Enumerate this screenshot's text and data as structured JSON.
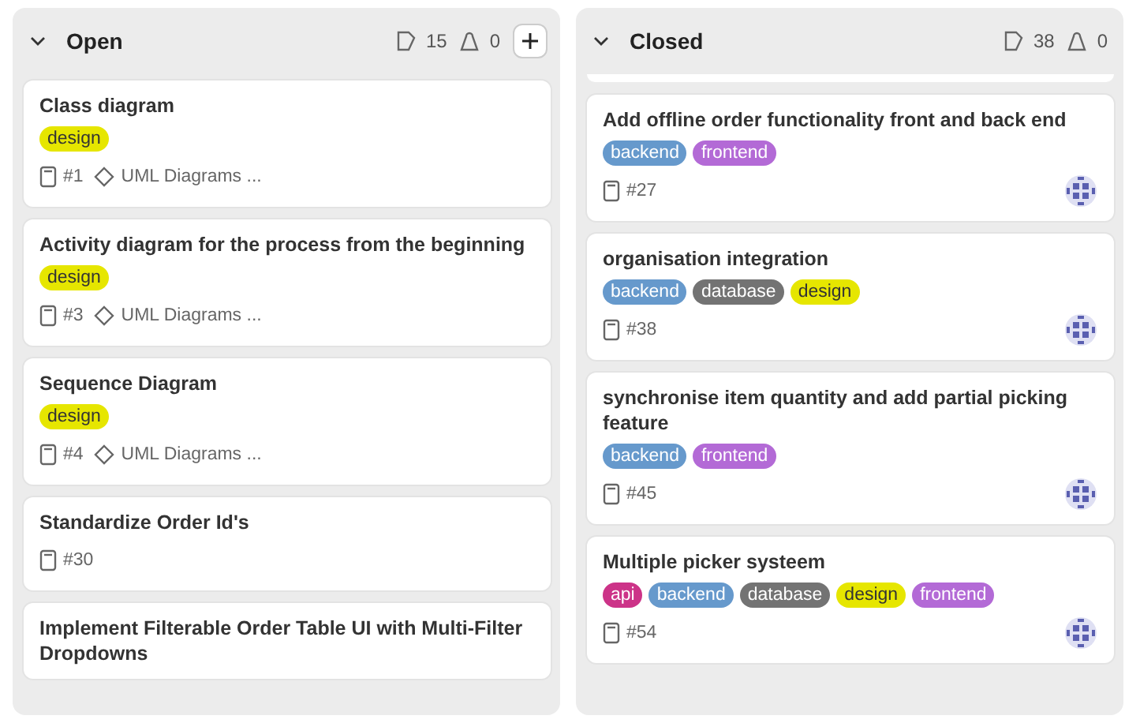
{
  "columns": [
    {
      "title": "Open",
      "issue_count": "15",
      "weight": "0",
      "can_add": true,
      "cards": [
        {
          "title": "Class diagram",
          "labels": [
            {
              "name": "design",
              "color": "#e6e600"
            }
          ],
          "number": "#1",
          "milestone": "UML Diagrams ..."
        },
        {
          "title": "Activity diagram for the process from the beginning",
          "labels": [
            {
              "name": "design",
              "color": "#e6e600"
            }
          ],
          "number": "#3",
          "milestone": "UML Diagrams ..."
        },
        {
          "title": "Sequence Diagram",
          "labels": [
            {
              "name": "design",
              "color": "#e6e600"
            }
          ],
          "number": "#4",
          "milestone": "UML Diagrams ..."
        },
        {
          "title": "Standardize Order Id's",
          "number": "#30"
        },
        {
          "title": "Implement Filterable Order Table UI with Multi-Filter Dropdowns"
        }
      ]
    },
    {
      "title": "Closed",
      "issue_count": "38",
      "weight": "0",
      "can_add": false,
      "partial_card_above": true,
      "cards": [
        {
          "title": "Add offline order functionality front and back end",
          "labels": [
            {
              "name": "backend",
              "color": "#6699cc"
            },
            {
              "name": "frontend",
              "color": "#b36ad6"
            }
          ],
          "number": "#27",
          "assigned": true
        },
        {
          "title": "organisation integration",
          "labels": [
            {
              "name": "backend",
              "color": "#6699cc"
            },
            {
              "name": "database",
              "color": "#737373"
            },
            {
              "name": "design",
              "color": "#e6e600"
            }
          ],
          "number": "#38",
          "assigned": true
        },
        {
          "title": "synchronise item quantity and add partial picking feature",
          "labels": [
            {
              "name": "backend",
              "color": "#6699cc"
            },
            {
              "name": "frontend",
              "color": "#b36ad6"
            }
          ],
          "number": "#45",
          "assigned": true
        },
        {
          "title": "Multiple picker systeem",
          "labels": [
            {
              "name": "api",
              "color": "#cc3388"
            },
            {
              "name": "backend",
              "color": "#6699cc"
            },
            {
              "name": "database",
              "color": "#737373"
            },
            {
              "name": "design",
              "color": "#e6e600"
            },
            {
              "name": "frontend",
              "color": "#b36ad6"
            }
          ],
          "number": "#54",
          "assigned": true
        }
      ]
    }
  ]
}
